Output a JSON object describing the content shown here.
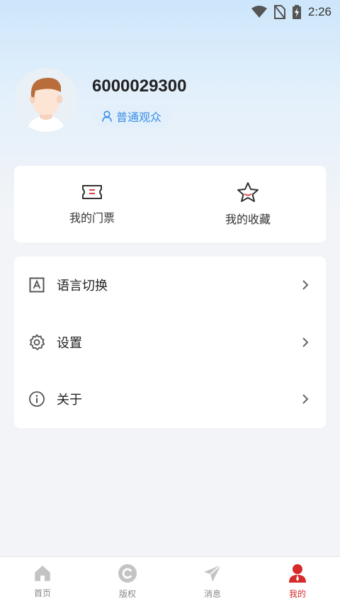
{
  "status_bar": {
    "time": "2:26"
  },
  "profile": {
    "user_id": "6000029300",
    "role": "普通观众"
  },
  "shortcuts": [
    {
      "label": "我的门票",
      "icon": "ticket-icon"
    },
    {
      "label": "我的收藏",
      "icon": "star-icon"
    }
  ],
  "menu": [
    {
      "label": "语言切换",
      "icon": "language-icon"
    },
    {
      "label": "设置",
      "icon": "gear-icon"
    },
    {
      "label": "关于",
      "icon": "info-icon"
    }
  ],
  "tabs": [
    {
      "label": "首页",
      "icon": "home-icon",
      "active": false
    },
    {
      "label": "版权",
      "icon": "copyright-icon",
      "active": false
    },
    {
      "label": "消息",
      "icon": "send-icon",
      "active": false
    },
    {
      "label": "我的",
      "icon": "user-icon",
      "active": true
    }
  ],
  "colors": {
    "accent": "#3a8ee6",
    "active_tab": "#d62b2b",
    "background": "#f2f4f7"
  }
}
